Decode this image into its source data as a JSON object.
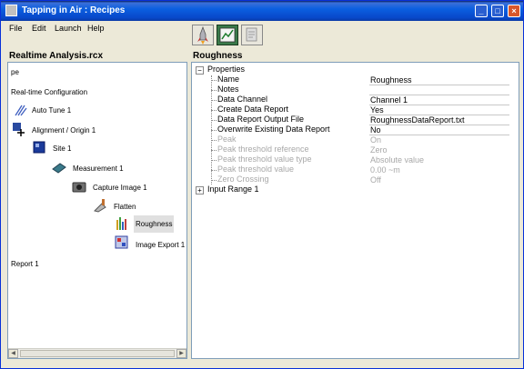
{
  "window": {
    "title": "Tapping in Air : Recipes"
  },
  "menu": [
    "File",
    "Edit",
    "Launch",
    "Help"
  ],
  "left_panel": {
    "title": "Realtime Analysis.rcx",
    "items": [
      "pe",
      "Real-time Configuration",
      "Auto Tune 1",
      "Alignment / Origin 1",
      "Site 1",
      "Measurement 1",
      "Capture Image 1",
      "Flatten",
      "Roughness",
      "Image Export 1",
      "Report 1"
    ]
  },
  "right_panel": {
    "title": "Roughness",
    "properties_label": "Properties",
    "properties": [
      {
        "label": "Name",
        "value": "Roughness",
        "dim": false
      },
      {
        "label": "Notes",
        "value": "",
        "dim": false
      },
      {
        "label": "Data Channel",
        "value": "Channel 1",
        "dim": false
      },
      {
        "label": "Create Data Report",
        "value": "Yes",
        "dim": false
      },
      {
        "label": "Data Report Output File",
        "value": "RoughnessDataReport.txt",
        "dim": false
      },
      {
        "label": "Overwrite Existing Data Report",
        "value": "No",
        "dim": false
      },
      {
        "label": "Peak",
        "value": "On",
        "dim": true
      },
      {
        "label": "Peak threshold reference",
        "value": "Zero",
        "dim": true
      },
      {
        "label": "Peak threshold value type",
        "value": "Absolute value",
        "dim": true
      },
      {
        "label": "Peak threshold value",
        "value": "0.00 ~m",
        "dim": true
      },
      {
        "label": "Zero Crossing",
        "value": "Off",
        "dim": true
      }
    ],
    "input_range_label": "Input Range 1"
  },
  "toolbar": {
    "icons": [
      "rocket-icon",
      "graph-icon",
      "document-icon"
    ]
  },
  "colors": {
    "titlebar": "#0b5fe0",
    "pane_border": "#7f9db9",
    "dim_text": "#a8a8a8"
  }
}
